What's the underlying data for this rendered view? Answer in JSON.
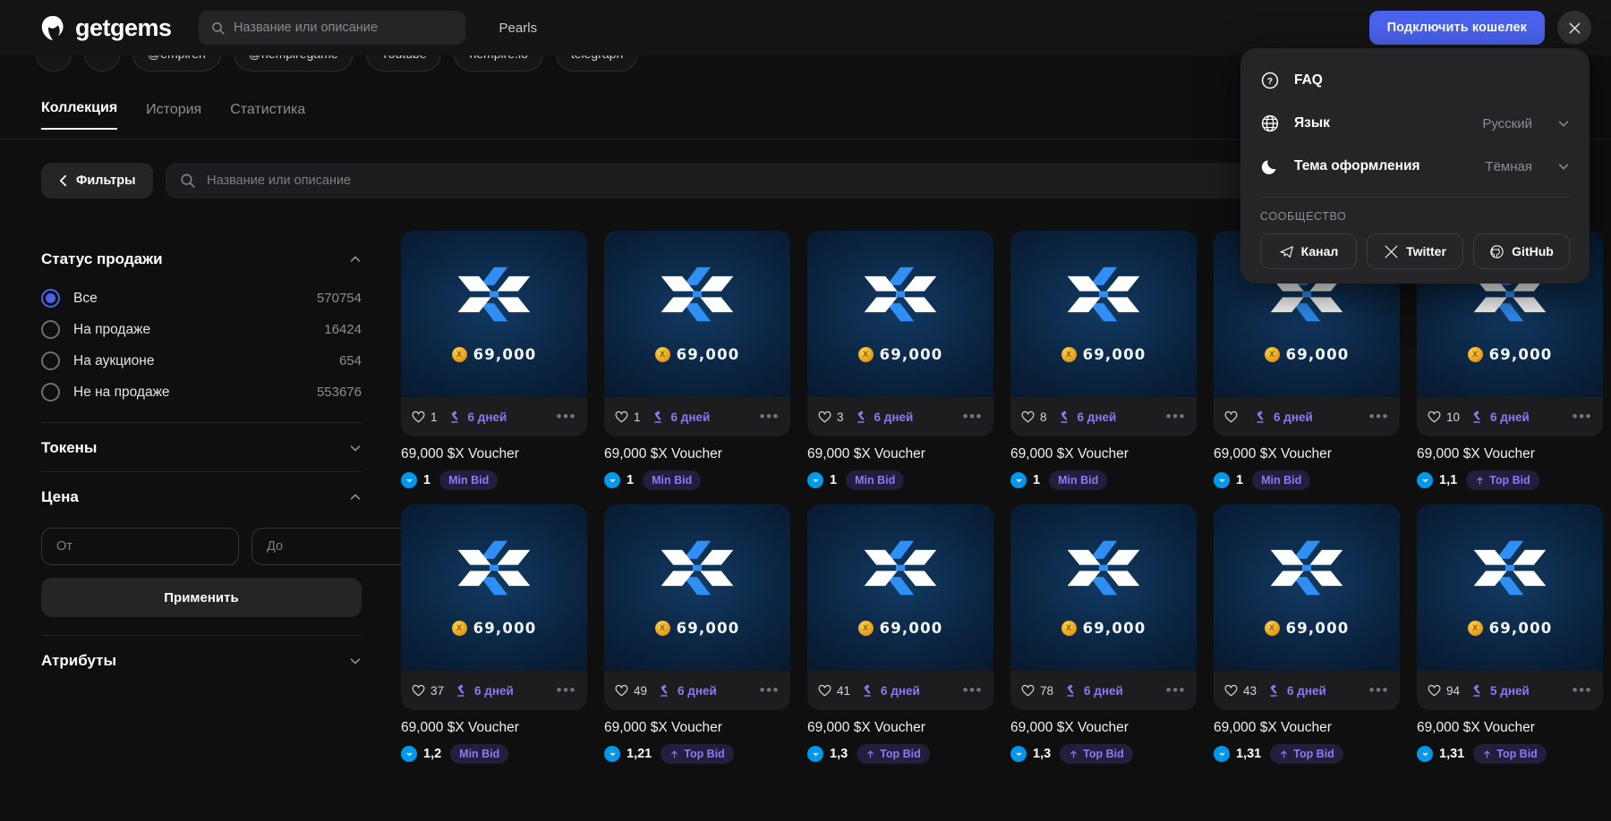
{
  "header": {
    "brand": "getgems",
    "search_placeholder": "Название или описание",
    "search_value": "",
    "nav_link": "Pearls",
    "connect_label": "Подключить кошелек",
    "close_label": "×"
  },
  "chips": [
    {
      "label": ""
    },
    {
      "label": ""
    },
    {
      "label": "@empiren"
    },
    {
      "label": "@hempiregame"
    },
    {
      "label": "Youtube"
    },
    {
      "label": "hempire.io"
    },
    {
      "label": "telegraph"
    }
  ],
  "tabs": [
    {
      "label": "Коллекция",
      "active": true
    },
    {
      "label": "История",
      "active": false
    },
    {
      "label": "Статистика",
      "active": false
    }
  ],
  "filterbar": {
    "filters_label": "Фильтры",
    "search_placeholder": "Название или описание",
    "search_value": ""
  },
  "sidebar": {
    "sale_status": {
      "title": "Статус продажи",
      "expanded": true,
      "options": [
        {
          "label": "Все",
          "count": "570754",
          "selected": true
        },
        {
          "label": "На продаже",
          "count": "16424",
          "selected": false
        },
        {
          "label": "На аукционе",
          "count": "654",
          "selected": false
        },
        {
          "label": "Не на продаже",
          "count": "553676",
          "selected": false
        }
      ]
    },
    "tokens": {
      "title": "Токены",
      "expanded": false
    },
    "price": {
      "title": "Цена",
      "expanded": true,
      "from_placeholder": "От",
      "from_value": "",
      "to_placeholder": "До",
      "to_value": "",
      "apply_label": "Применить"
    },
    "attributes": {
      "title": "Атрибуты",
      "expanded": false
    }
  },
  "menu": {
    "faq": {
      "label": "FAQ",
      "icon": "question-circle-icon"
    },
    "language": {
      "label": "Язык",
      "value": "Русский",
      "icon": "globe-icon"
    },
    "theme": {
      "label": "Тема оформления",
      "value": "Тёмная",
      "icon": "moon-icon"
    },
    "community_title": "СООБЩЕСТВО",
    "social": [
      {
        "label": "Канал",
        "icon": "telegram-icon"
      },
      {
        "label": "Twitter",
        "icon": "x-twitter-icon"
      },
      {
        "label": "GitHub",
        "icon": "github-icon"
      }
    ]
  },
  "colors": {
    "accent": "#4a63ed",
    "purple": "#8b7bf0",
    "ton_blue": "#0098ea",
    "bg": "#0f0f10",
    "panel": "#1d1d1f"
  },
  "cards": [
    {
      "art_amount": "69,000",
      "likes": "1",
      "auction": "6 дней",
      "title": "69,000 $X Voucher",
      "price": "1",
      "badge": "Min Bid",
      "badge_type": "min"
    },
    {
      "art_amount": "69,000",
      "likes": "1",
      "auction": "6 дней",
      "title": "69,000 $X Voucher",
      "price": "1",
      "badge": "Min Bid",
      "badge_type": "min"
    },
    {
      "art_amount": "69,000",
      "likes": "3",
      "auction": "6 дней",
      "title": "69,000 $X Voucher",
      "price": "1",
      "badge": "Min Bid",
      "badge_type": "min"
    },
    {
      "art_amount": "69,000",
      "likes": "8",
      "auction": "6 дней",
      "title": "69,000 $X Voucher",
      "price": "1",
      "badge": "Min Bid",
      "badge_type": "min"
    },
    {
      "art_amount": "69,000",
      "likes": "",
      "auction": "6 дней",
      "title": "69,000 $X Voucher",
      "price": "1",
      "badge": "Min Bid",
      "badge_type": "min"
    },
    {
      "art_amount": "69,000",
      "likes": "10",
      "auction": "6 дней",
      "title": "69,000 $X Voucher",
      "price": "1,1",
      "badge": "Top Bid",
      "badge_type": "top"
    },
    {
      "art_amount": "69,000",
      "likes": "37",
      "auction": "6 дней",
      "title": "69,000 $X Voucher",
      "price": "1,2",
      "badge": "Min Bid",
      "badge_type": "min"
    },
    {
      "art_amount": "69,000",
      "likes": "49",
      "auction": "6 дней",
      "title": "69,000 $X Voucher",
      "price": "1,21",
      "badge": "Top Bid",
      "badge_type": "top"
    },
    {
      "art_amount": "69,000",
      "likes": "41",
      "auction": "6 дней",
      "title": "69,000 $X Voucher",
      "price": "1,3",
      "badge": "Top Bid",
      "badge_type": "top"
    },
    {
      "art_amount": "69,000",
      "likes": "78",
      "auction": "6 дней",
      "title": "69,000 $X Voucher",
      "price": "1,3",
      "badge": "Top Bid",
      "badge_type": "top"
    },
    {
      "art_amount": "69,000",
      "likes": "43",
      "auction": "6 дней",
      "title": "69,000 $X Voucher",
      "price": "1,31",
      "badge": "Top Bid",
      "badge_type": "top"
    },
    {
      "art_amount": "69,000",
      "likes": "94",
      "auction": "5 дней",
      "title": "69,000 $X Voucher",
      "price": "1,31",
      "badge": "Top Bid",
      "badge_type": "top"
    }
  ]
}
